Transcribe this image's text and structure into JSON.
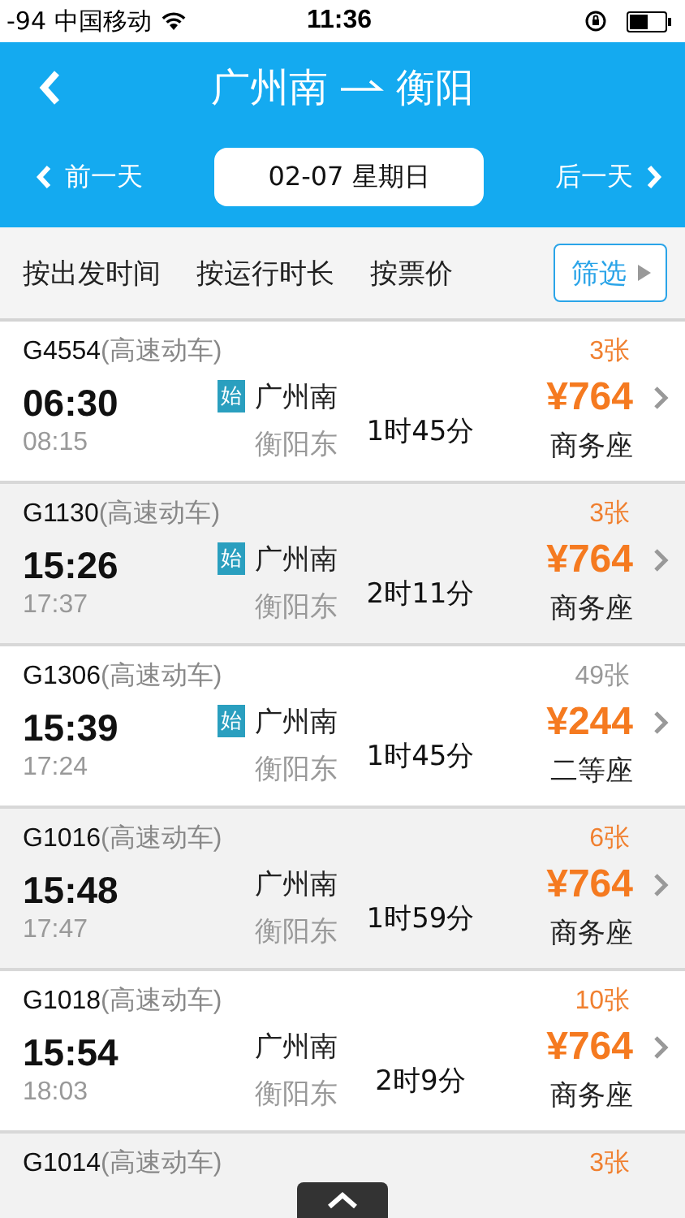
{
  "status_bar": {
    "signal": "-94",
    "carrier": "中国移动",
    "time": "11:36"
  },
  "nav": {
    "from": "广州南",
    "to": "衡阳"
  },
  "date_bar": {
    "prev": "前一天",
    "date": "02-07 星期日",
    "next": "后一天"
  },
  "sort_options": [
    {
      "label": "按出发时间"
    },
    {
      "label": "按运行时长"
    },
    {
      "label": "按票价"
    }
  ],
  "filter_button": "筛选",
  "trains": [
    {
      "number": "G4554",
      "type": "(高速动车)",
      "tickets": "3张",
      "few_left": true,
      "depart": "06:30",
      "arrive": "08:15",
      "start_badge": "始",
      "from": "广州南",
      "to": "衡阳东",
      "duration": "1时45分",
      "price": "¥764",
      "seat": "商务座"
    },
    {
      "number": "G1130",
      "type": "(高速动车)",
      "tickets": "3张",
      "few_left": true,
      "depart": "15:26",
      "arrive": "17:37",
      "start_badge": "始",
      "from": "广州南",
      "to": "衡阳东",
      "duration": "2时11分",
      "price": "¥764",
      "seat": "商务座"
    },
    {
      "number": "G1306",
      "type": "(高速动车)",
      "tickets": "49张",
      "few_left": false,
      "depart": "15:39",
      "arrive": "17:24",
      "start_badge": "始",
      "from": "广州南",
      "to": "衡阳东",
      "duration": "1时45分",
      "price": "¥244",
      "seat": "二等座"
    },
    {
      "number": "G1016",
      "type": "(高速动车)",
      "tickets": "6张",
      "few_left": true,
      "depart": "15:48",
      "arrive": "17:47",
      "from": "广州南",
      "to": "衡阳东",
      "duration": "1时59分",
      "price": "¥764",
      "seat": "商务座"
    },
    {
      "number": "G1018",
      "type": "(高速动车)",
      "tickets": "10张",
      "few_left": true,
      "depart": "15:54",
      "arrive": "18:03",
      "from": "广州南",
      "to": "衡阳东",
      "duration": "2时9分",
      "price": "¥764",
      "seat": "商务座"
    },
    {
      "number": "G1014",
      "type": "(高速动车)",
      "tickets": "3张",
      "few_left": true
    }
  ]
}
